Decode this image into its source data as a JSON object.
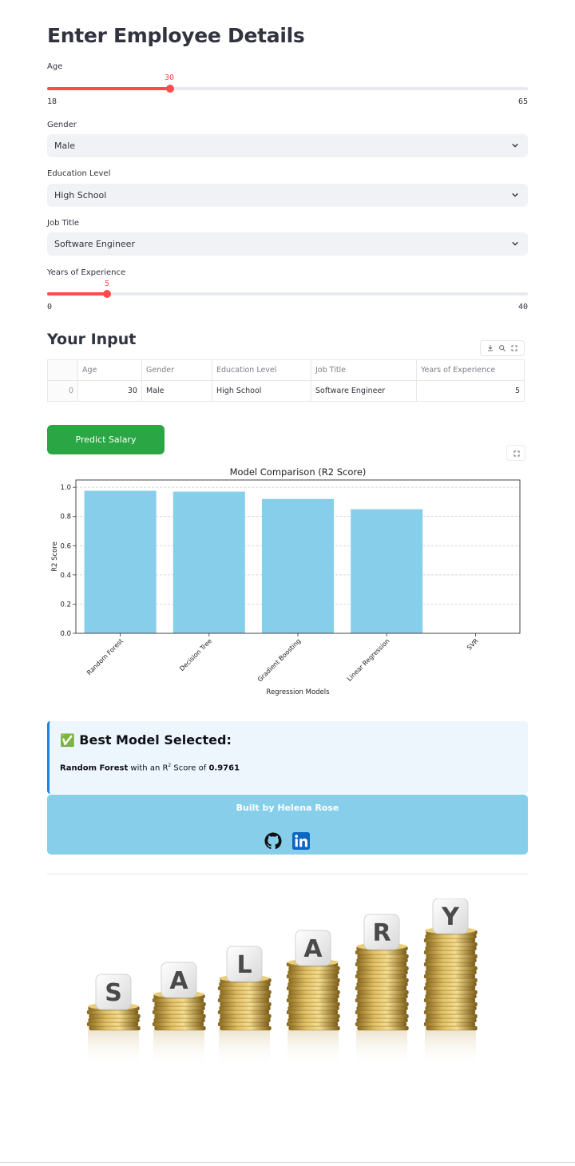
{
  "header": {
    "title": "Enter Employee Details"
  },
  "form": {
    "age": {
      "label": "Age",
      "value": "30",
      "min": "18",
      "max": "65",
      "fraction": 0.255
    },
    "gender": {
      "label": "Gender",
      "value": "Male"
    },
    "education": {
      "label": "Education Level",
      "value": "High School"
    },
    "job": {
      "label": "Job Title",
      "value": "Software Engineer"
    },
    "experience": {
      "label": "Years of Experience",
      "value": "5",
      "min": "0",
      "max": "40",
      "fraction": 0.125
    }
  },
  "input_section": {
    "title": "Your Input",
    "columns": [
      "Age",
      "Gender",
      "Education Level",
      "Job Title",
      "Years of Experience"
    ],
    "row": {
      "index": "0",
      "age": "30",
      "gender": "Male",
      "education": "High School",
      "job": "Software Engineer",
      "experience": "5"
    }
  },
  "predict_button": "Predict Salary",
  "chart_data": {
    "type": "bar",
    "title": "Model Comparison (R2 Score)",
    "xlabel": "Regression Models",
    "ylabel": "R2 Score",
    "categories": [
      "Random Forest",
      "Decision Tree",
      "Gradient Boosting",
      "Linear Regression",
      "SVR"
    ],
    "values": [
      0.976,
      0.97,
      0.92,
      0.85,
      0.0
    ],
    "yticks": [
      "0.0",
      "0.2",
      "0.4",
      "0.6",
      "0.8",
      "1.0"
    ],
    "ylim": [
      0,
      1.05
    ],
    "grid": "horizontal dashed",
    "bar_color": "#87ceeb"
  },
  "best_model": {
    "icon": "✅",
    "title": "Best Model Selected:",
    "model": "Random Forest",
    "text_mid": " with an R",
    "sup": "2",
    "text_tail": " Score of ",
    "score": "0.9761"
  },
  "footer": {
    "text": "Built by Helena Rose"
  },
  "banner": {
    "letters": [
      "S",
      "A",
      "L",
      "A",
      "R",
      "Y"
    ]
  },
  "colors": {
    "accent": "#ff4b4b",
    "button": "#2aa744",
    "info_bg": "#eef6fd",
    "info_border": "#1c83e1",
    "footer_bg": "#87ceeb"
  }
}
